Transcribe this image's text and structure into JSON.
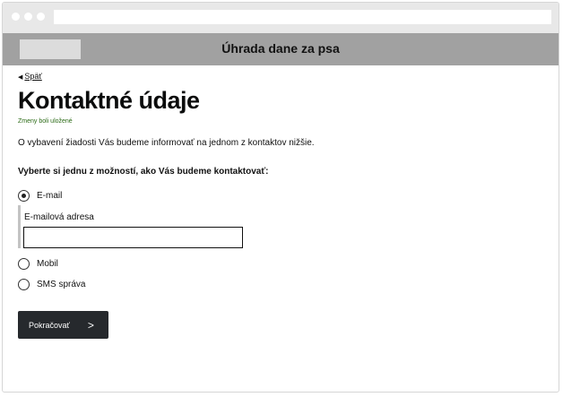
{
  "app": {
    "title": "Úhrada dane za psa"
  },
  "nav": {
    "back_label": "Späť"
  },
  "page": {
    "heading": "Kontaktné údaje",
    "saved_notice": "Zmeny boli uložené",
    "info_text": "O vybavení žiadosti Vás budeme informovať na jednom z kontaktov nižšie.",
    "question": "Vyberte si jednu z možností, ako Vás budeme kontaktovať:"
  },
  "options": [
    {
      "label": "E-mail",
      "selected": true
    },
    {
      "label": "Mobil",
      "selected": false
    },
    {
      "label": "SMS správa",
      "selected": false
    }
  ],
  "email_field": {
    "label": "E-mailová adresa",
    "value": "",
    "placeholder": ""
  },
  "actions": {
    "continue_label": "Pokračovať",
    "continue_icon": "chevron-right-icon"
  },
  "colors": {
    "app_bar": "#a1a1a1",
    "saved_text": "#2b6a16",
    "button_bg": "#26292d"
  }
}
